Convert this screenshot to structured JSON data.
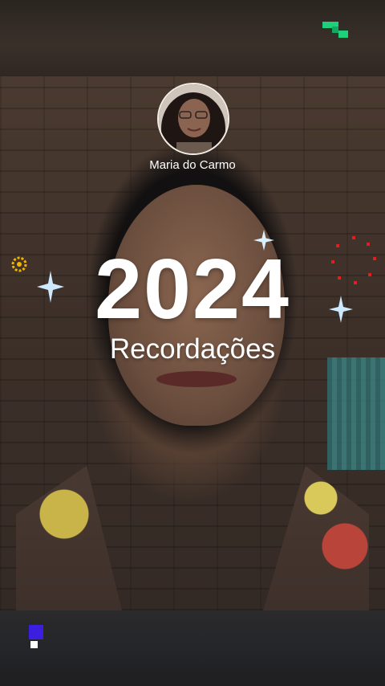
{
  "memory": {
    "profile_name": "Maria do Carmo",
    "year": "2024",
    "subtitle": "Recordações"
  },
  "colors": {
    "text": "#ffffff",
    "brand_green": "#1fd07a",
    "brand_blue": "#3a1fe0",
    "sparkle": "#bfe6ff",
    "ring_red": "#e02020",
    "ring_yellow": "#f0b400"
  },
  "icons": [
    "brand-logo-icon",
    "sparkle-icon",
    "firework-ring-icon",
    "sun-ring-icon"
  ]
}
